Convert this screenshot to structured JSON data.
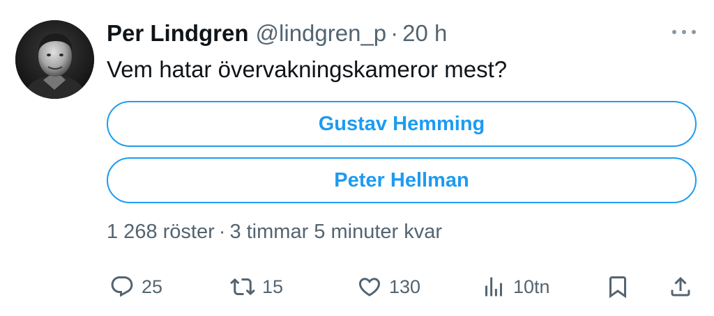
{
  "author": {
    "name": "Per Lindgren",
    "handle": "@lindgren_p",
    "separator": "·",
    "time": "20 h"
  },
  "tweet": {
    "text": "Vem hatar övervakningskameror mest?"
  },
  "poll": {
    "options": [
      {
        "label": "Gustav Hemming"
      },
      {
        "label": "Peter Hellman"
      }
    ],
    "votes": "1 268 röster",
    "separator": "·",
    "remaining": "3 timmar 5 minuter kvar"
  },
  "actions": {
    "reply_count": "25",
    "retweet_count": "15",
    "like_count": "130",
    "views_count": "10tn"
  },
  "icons": {
    "more": "more-dots-icon",
    "reply": "reply-bubble-icon",
    "retweet": "retweet-arrows-icon",
    "like": "heart-icon",
    "views": "views-bar-chart-icon",
    "bookmark": "bookmark-icon",
    "share": "share-upload-icon"
  },
  "colors": {
    "accent": "#1d9bf0",
    "text": "#0f1419",
    "secondary": "#536471"
  }
}
